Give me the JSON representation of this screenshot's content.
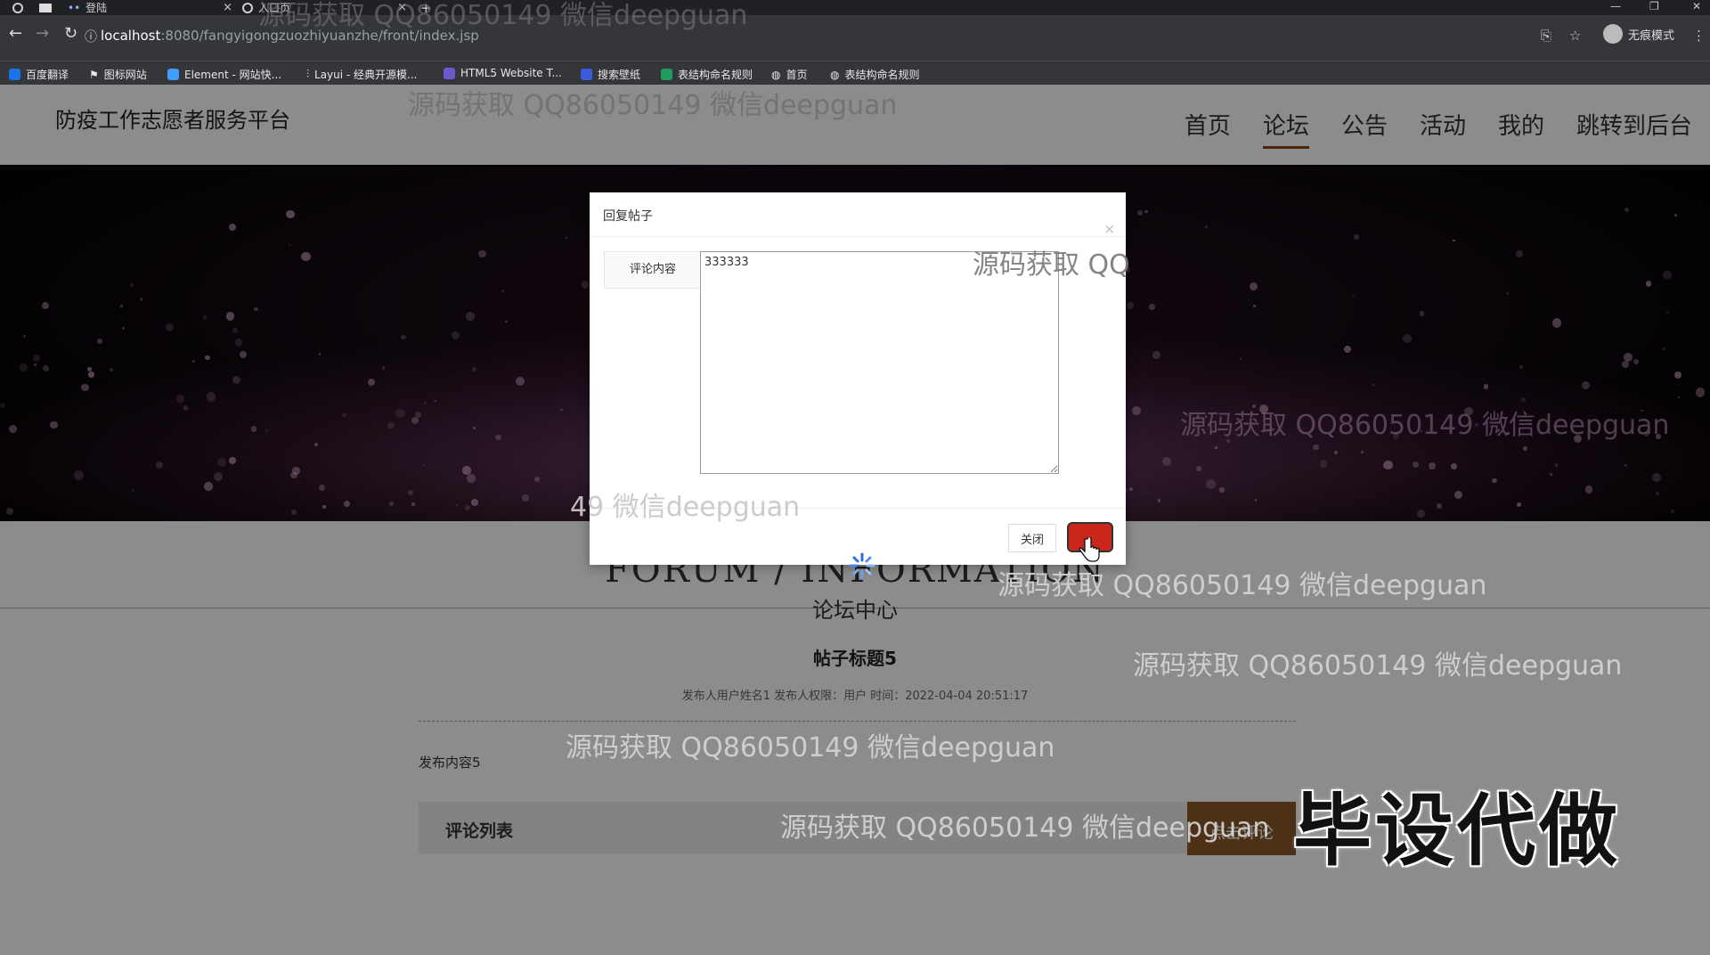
{
  "browser": {
    "tabs": [
      {
        "label": "登陆"
      },
      {
        "label": "入口页"
      }
    ],
    "new_tab": "+",
    "url_host": "localhost",
    "url_rest": ":8080/fangyigongzuozhiyuanzhe/front/index.jsp",
    "profile_label": "无痕模式",
    "bookmarks": [
      {
        "label": "百度翻译",
        "color": "#1a73e8"
      },
      {
        "label": "图标网站",
        "color": "#ffffff"
      },
      {
        "label": "Element - 网站快...",
        "color": "#409eff"
      },
      {
        "label": "Layui - 经典开源模...",
        "color": "#aaaaaa"
      },
      {
        "label": "HTML5 Website T...",
        "color": "#6a5acd"
      },
      {
        "label": "搜索壁纸",
        "color": "#3b5bdb"
      },
      {
        "label": "表结构命名规则",
        "color": "#1e9e5a"
      },
      {
        "label": "首页",
        "color": "#dddddd"
      },
      {
        "label": "表结构命名规则",
        "color": "#dddddd"
      }
    ]
  },
  "site": {
    "title": "防疫工作志愿者服务平台",
    "nav": [
      {
        "label": "首页",
        "active": false
      },
      {
        "label": "论坛",
        "active": true
      },
      {
        "label": "公告",
        "active": false
      },
      {
        "label": "活动",
        "active": false
      },
      {
        "label": "我的",
        "active": false
      },
      {
        "label": "跳转到后台",
        "active": false
      }
    ]
  },
  "page": {
    "section_en": "FORUM / INFORMATION",
    "section_cn": "论坛中心",
    "post_title": "帖子标题5",
    "post_meta": "发布人用户姓名1   发布人权限：用户   时间：2022-04-04 20:51:17",
    "post_content": "发布内容5",
    "comment_list_label": "评论列表",
    "comment_button": "点击评论"
  },
  "modal": {
    "title": "回复帖子",
    "close_icon": "×",
    "field_label": "评论内容",
    "field_value": "333333",
    "cancel_label": "关闭",
    "ok_label": ""
  },
  "watermarks": {
    "text": "源码获取 QQ86050149 微信deepguan",
    "partial_left": "49 微信deepguan",
    "partial_right": "源码获取 QQ",
    "partial_comment": "源码获取 QQ86050149 微信deepguan",
    "stamp": "毕设代做"
  },
  "colors": {
    "accent_brown": "#8b5a2b",
    "confirm_red": "#c9261c",
    "nav_underline": "#8b4513"
  }
}
